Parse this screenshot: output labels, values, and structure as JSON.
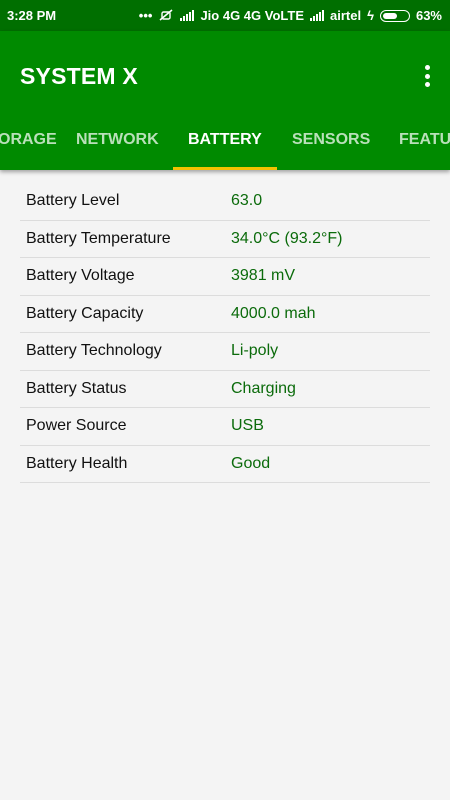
{
  "status_bar": {
    "time": "3:28 PM",
    "carrier_1": "Jio 4G 4G VoLTE",
    "carrier_2": "airtel",
    "battery_percent": "63%",
    "battery_level": 0.63,
    "icons": [
      "notification-dots-icon",
      "mute-icon",
      "signal-icon",
      "charging-icon",
      "battery-icon"
    ]
  },
  "app_bar": {
    "title": "SYSTEM X",
    "menu_icon": "overflow-menu-icon"
  },
  "tabs": [
    {
      "label": "ORAGE"
    },
    {
      "label": "NETWORK"
    },
    {
      "label": "BATTERY"
    },
    {
      "label": "SENSORS"
    },
    {
      "label": "FEATU"
    }
  ],
  "active_tab": "BATTERY",
  "battery_info": [
    {
      "label": "Battery Level",
      "value": "63.0"
    },
    {
      "label": "Battery Temperature",
      "value": "34.0°C (93.2°F)"
    },
    {
      "label": "Battery Voltage",
      "value": "3981 mV"
    },
    {
      "label": "Battery Capacity",
      "value": "4000.0 mah"
    },
    {
      "label": "Battery Technology",
      "value": "Li-poly"
    },
    {
      "label": "Battery Status",
      "value": "Charging"
    },
    {
      "label": "Power Source",
      "value": "USB"
    },
    {
      "label": "Battery Health",
      "value": "Good"
    }
  ],
  "colors": {
    "status_bar": "#006f00",
    "app_bar": "#008a00",
    "tab_indicator": "#f3c200",
    "value_text": "#0b6b0b",
    "background": "#f4f4f4"
  }
}
